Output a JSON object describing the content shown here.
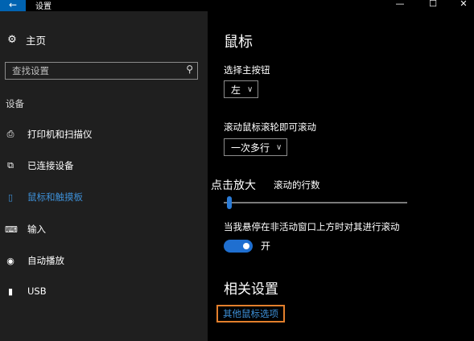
{
  "window": {
    "title": "设置",
    "back_icon": "←",
    "minimize": "—",
    "maximize": "☐",
    "close": "✕"
  },
  "sidebar": {
    "home_label": "主页",
    "search_placeholder": "查找设置",
    "section": "设备",
    "items": [
      {
        "label": "打印机和扫描仪",
        "icon": "printer-icon",
        "glyph": "⎙"
      },
      {
        "label": "已连接设备",
        "icon": "device-icon",
        "glyph": "⧉"
      },
      {
        "label": "鼠标和触摸板",
        "icon": "mouse-icon",
        "glyph": "▯",
        "active": true
      },
      {
        "label": "输入",
        "icon": "keyboard-icon",
        "glyph": "⌨"
      },
      {
        "label": "自动播放",
        "icon": "autoplay-icon",
        "glyph": "◉"
      },
      {
        "label": "USB",
        "icon": "usb-icon",
        "glyph": "▮"
      }
    ]
  },
  "main": {
    "title": "鼠标",
    "primary_button_label": "选择主按钮",
    "primary_button_value": "左",
    "wheel_label": "滚动鼠标滚轮即可滚动",
    "wheel_value": "一次多行",
    "lines_label_partial": "滚动的行数",
    "zoom_overlay": "点击放大",
    "inactive_scroll_label": "当我悬停在非活动窗口上方时对其进行滚动",
    "toggle_state": "开",
    "related_title": "相关设置",
    "related_link": "其他鼠标选项"
  },
  "colors": {
    "accent": "#0063b1",
    "link": "#3d8fd6",
    "highlight_box": "#e37f2c",
    "toggle_on": "#1f6fd0"
  }
}
